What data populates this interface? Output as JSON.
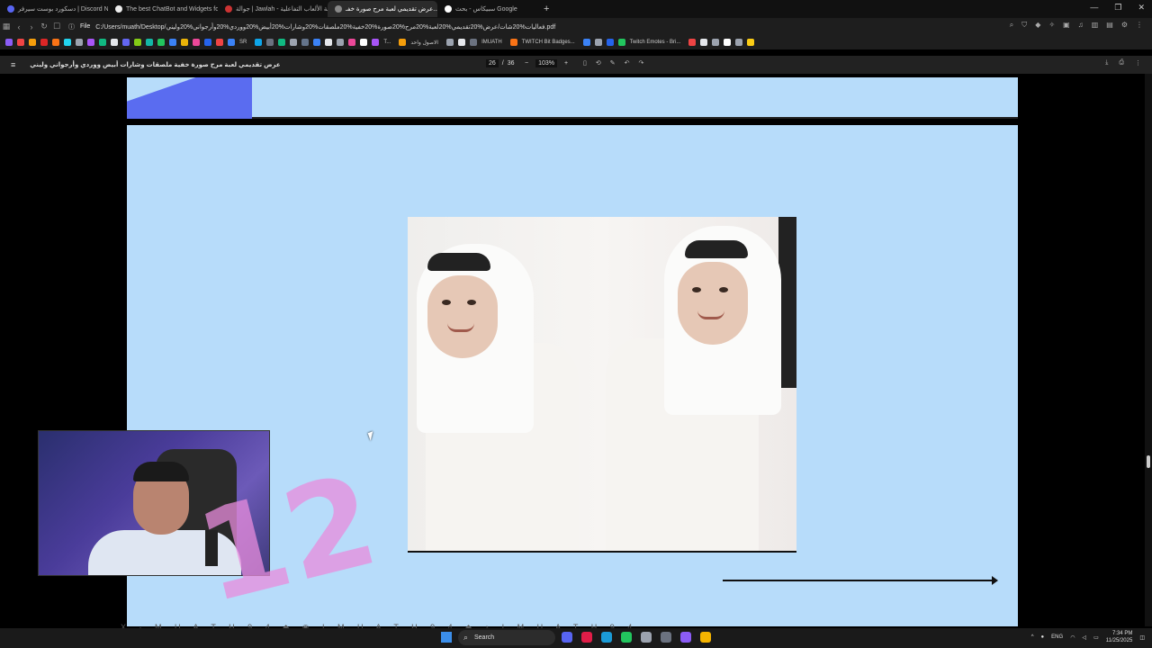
{
  "tabs": [
    {
      "title": "دسكورد بوست سيرفر | Discord Nitro",
      "fav": "#5865f2"
    },
    {
      "title": "The best ChatBot and Widgets for K...",
      "fav": "#eeeeee"
    },
    {
      "title": "جوالة | Jawlah - منصة الألعاب التفاعلية",
      "fav": "#cc3333"
    },
    {
      "title": "عرض تقديمي لعبة مرح صورة خفـ...",
      "fav": "#888888",
      "active": true
    },
    {
      "title": "سبيكاس - بحث Google",
      "fav": "#ffffff"
    }
  ],
  "new_tab": "+",
  "window_controls": [
    "—",
    "❐",
    "✕"
  ],
  "address": {
    "label": "File",
    "url": "C:/Users/muath/Desktop/فعاليات%20شات/عرض%20تقديمي%20لعبة%20مرح%20صورة%20خفية%20ملصقات%20وشارات%20أبيض%20ووردي%20وأرجواني%20وليني.pdf"
  },
  "bookmarks": [
    {
      "label": "",
      "color": "#8b5cf6"
    },
    {
      "label": "",
      "color": "#ef4444"
    },
    {
      "label": "",
      "color": "#f59e0b"
    },
    {
      "label": "",
      "color": "#dc2626"
    },
    {
      "label": "",
      "color": "#f97316"
    },
    {
      "label": "",
      "color": "#22d3ee"
    },
    {
      "label": "",
      "color": "#9ca3af"
    },
    {
      "label": "",
      "color": "#a855f7"
    },
    {
      "label": "",
      "color": "#10b981"
    },
    {
      "label": "",
      "color": "#e5e7eb"
    },
    {
      "label": "",
      "color": "#6366f1"
    },
    {
      "label": "",
      "color": "#84cc16"
    },
    {
      "label": "",
      "color": "#14b8a6"
    },
    {
      "label": "",
      "color": "#22c55e"
    },
    {
      "label": "",
      "color": "#3b82f6"
    },
    {
      "label": "",
      "color": "#eab308"
    },
    {
      "label": "",
      "color": "#ec4899"
    },
    {
      "label": "",
      "color": "#2563eb"
    },
    {
      "label": "",
      "color": "#ef4444"
    },
    {
      "label": "SR",
      "color": "#3b82f6"
    },
    {
      "label": "",
      "color": "#0ea5e9"
    },
    {
      "label": "",
      "color": "#6b7280"
    },
    {
      "label": "",
      "color": "#10b981"
    },
    {
      "label": "",
      "color": "#9ca3af"
    },
    {
      "label": "",
      "color": "#64748b"
    },
    {
      "label": "",
      "color": "#3b82f6"
    },
    {
      "label": "",
      "color": "#e5e7eb"
    },
    {
      "label": "",
      "color": "#9ca3af"
    },
    {
      "label": "",
      "color": "#ec4899"
    },
    {
      "label": "",
      "color": "#ffffff"
    },
    {
      "label": "T...",
      "color": "#a855f7"
    },
    {
      "label": "الاصول واحد",
      "color": "#f59e0b"
    },
    {
      "label": "",
      "color": "#9ca3af"
    },
    {
      "label": "",
      "color": "#e5e7eb"
    },
    {
      "label": "IMUATH",
      "color": "#6b7280"
    },
    {
      "label": "TWITCH Bit Badges...",
      "color": "#f97316"
    },
    {
      "label": "",
      "color": "#3b82f6"
    },
    {
      "label": "",
      "color": "#9ca3af"
    },
    {
      "label": "",
      "color": "#2563eb"
    },
    {
      "label": "Twitch Emotes - Bri...",
      "color": "#22c55e"
    },
    {
      "label": "",
      "color": "#ef4444"
    },
    {
      "label": "",
      "color": "#e5e7eb"
    },
    {
      "label": "",
      "color": "#9ca3af"
    },
    {
      "label": "",
      "color": "#ffffff"
    },
    {
      "label": "",
      "color": "#9ca3af"
    },
    {
      "label": "",
      "color": "#facc15"
    }
  ],
  "pdf": {
    "title": "عرض تقديمي لعبة مرح صورة خفية ملصقات وشارات أبيض ووردي وأرجواني وليني",
    "page_current": "26",
    "page_sep": "/",
    "page_total": "36",
    "zoom_minus": "−",
    "zoom": "103%",
    "zoom_plus": "+"
  },
  "stream_overlay": {
    "big_number": "12",
    "footer_text": "X · M U A T H 9 4 ◆ ◉ I M U A T H 9 4 ◆ ♪ I M U A T H 9 4"
  },
  "taskbar": {
    "search_placeholder": "Search",
    "apps": [
      "#5865f2",
      "#e11d48",
      "#1b9bd7",
      "#22c55e",
      "#9ca3af",
      "#6b7280",
      "#8b5cf6",
      "#f5b400"
    ],
    "lang": "ENG",
    "time": "7:34 PM",
    "date": "11/25/2025"
  }
}
